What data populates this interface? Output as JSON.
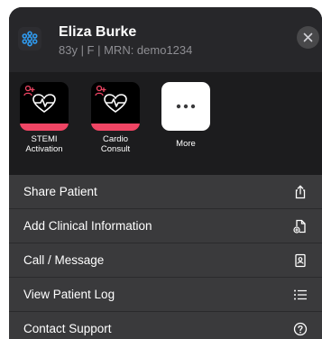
{
  "patient": {
    "name": "Eliza Burke",
    "meta": "83y | F | MRN: demo1234"
  },
  "shortcuts": [
    {
      "label": "STEMI\nActivation",
      "icon": "heartbeat-person-icon"
    },
    {
      "label": "Cardio\nConsult",
      "icon": "heartbeat-person-icon"
    },
    {
      "label": "More",
      "icon": "ellipsis-icon"
    }
  ],
  "menu": [
    {
      "label": "Share Patient",
      "icon": "share-icon"
    },
    {
      "label": "Add Clinical Information",
      "icon": "add-document-icon"
    },
    {
      "label": "Call / Message",
      "icon": "contact-card-icon"
    },
    {
      "label": "View Patient Log",
      "icon": "list-icon"
    },
    {
      "label": "Contact Support",
      "icon": "help-circle-icon"
    }
  ],
  "colors": {
    "accent": "#ef4564",
    "logo": "#2f9bf0",
    "sheet": "#1c1c1e",
    "menu_row": "#3a3a3c"
  }
}
